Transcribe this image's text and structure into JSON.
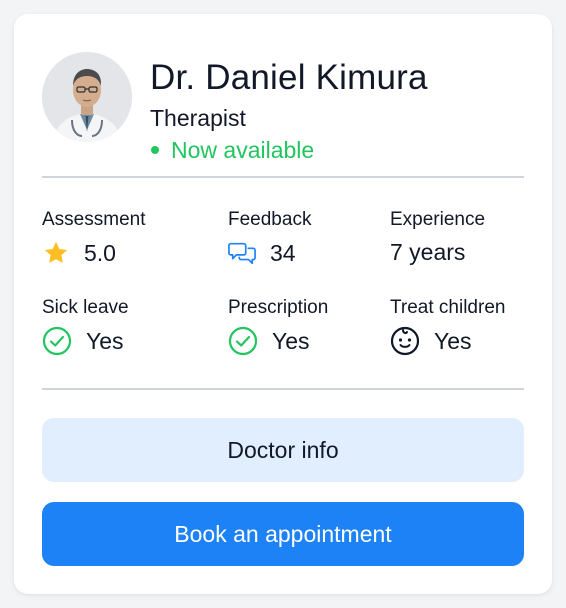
{
  "doctor": {
    "name": "Dr. Daniel Kimura",
    "role": "Therapist",
    "status": "Now available",
    "status_color": "#22c55e"
  },
  "stats": [
    {
      "label": "Assessment",
      "value": "5.0",
      "icon": "star-icon"
    },
    {
      "label": "Feedback",
      "value": "34",
      "icon": "chat-bubbles-icon"
    },
    {
      "label": "Experience",
      "value": "7 years",
      "icon": ""
    },
    {
      "label": "Sick leave",
      "value": "Yes",
      "icon": "check-circle-icon"
    },
    {
      "label": "Prescription",
      "value": "Yes",
      "icon": "check-circle-icon"
    },
    {
      "label": "Treat children",
      "value": "Yes",
      "icon": "baby-face-icon"
    }
  ],
  "actions": {
    "info_label": "Doctor info",
    "book_label": "Book an appointment"
  },
  "colors": {
    "accent": "#1d82f5",
    "accent_light": "#e0eefe",
    "success": "#22c55e",
    "star": "#fbbf24"
  }
}
